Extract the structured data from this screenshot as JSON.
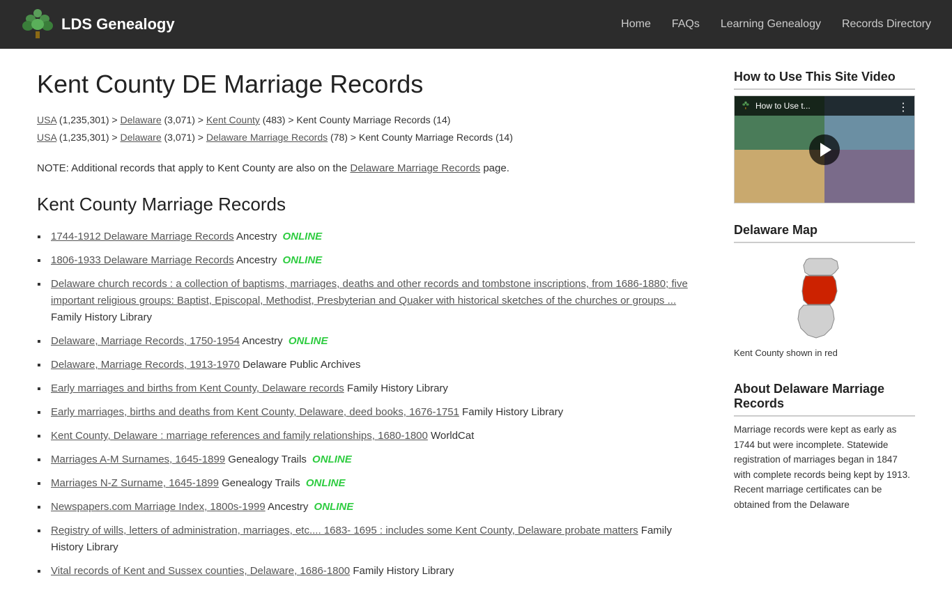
{
  "nav": {
    "logo_text": "LDS Genealogy",
    "links": [
      {
        "label": "Home",
        "href": "#"
      },
      {
        "label": "FAQs",
        "href": "#"
      },
      {
        "label": "Learning Genealogy",
        "href": "#"
      },
      {
        "label": "Records Directory",
        "href": "#"
      }
    ]
  },
  "main": {
    "page_title": "Kent County DE Marriage Records",
    "breadcrumbs": [
      {
        "line": "USA (1,235,301) > Delaware (3,071) > Kent County (483) > Kent County Marriage Records (14)",
        "links": [
          "USA",
          "Delaware",
          "Kent County"
        ]
      },
      {
        "line": "USA (1,235,301) > Delaware (3,071) > Delaware Marriage Records (78) > Kent County Marriage Records (14)",
        "links": [
          "USA",
          "Delaware",
          "Delaware Marriage Records"
        ]
      }
    ],
    "note": "NOTE: Additional records that apply to Kent County are also on the Delaware Marriage Records page.",
    "note_link": "Delaware Marriage Records",
    "section_title": "Kent County Marriage Records",
    "records": [
      {
        "link_text": "1744-1912 Delaware Marriage Records",
        "source": "Ancestry",
        "online": true
      },
      {
        "link_text": "1806-1933 Delaware Marriage Records",
        "source": "Ancestry",
        "online": true
      },
      {
        "link_text": "Delaware church records : a collection of baptisms, marriages, deaths and other records and tombstone inscriptions, from 1686-1880; five important religious groups: Baptist, Episcopal, Methodist, Presbyterian and Quaker with historical sketches of the churches or groups ...",
        "source": "Family History Library",
        "online": false
      },
      {
        "link_text": "Delaware, Marriage Records, 1750-1954",
        "source": "Ancestry",
        "online": true
      },
      {
        "link_text": "Delaware, Marriage Records, 1913-1970",
        "source": "Delaware Public Archives",
        "online": false
      },
      {
        "link_text": "Early marriages and births from Kent County, Delaware records",
        "source": "Family History Library",
        "online": false
      },
      {
        "link_text": "Early marriages, births and deaths from Kent County, Delaware, deed books, 1676-1751",
        "source": "Family History Library",
        "online": false
      },
      {
        "link_text": "Kent County, Delaware : marriage references and family relationships, 1680-1800",
        "source": "WorldCat",
        "online": false
      },
      {
        "link_text": "Marriages A-M Surnames, 1645-1899",
        "source": "Genealogy Trails",
        "online": true
      },
      {
        "link_text": "Marriages N-Z Surname, 1645-1899",
        "source": "Genealogy Trails",
        "online": true
      },
      {
        "link_text": "Newspapers.com Marriage Index, 1800s-1999",
        "source": "Ancestry",
        "online": true
      },
      {
        "link_text": "Registry of wills, letters of administration, marriages, etc.... 1683- 1695 : includes some Kent County, Delaware probate matters",
        "source": "Family History Library",
        "online": false
      },
      {
        "link_text": "Vital records of Kent and Sussex counties, Delaware, 1686-1800",
        "source": "Family History Library",
        "online": false
      }
    ]
  },
  "sidebar": {
    "video_section_title": "How to Use This Site Video",
    "video_label": "How to Use t...",
    "map_section_title": "Delaware Map",
    "map_caption": "Kent County shown in red",
    "about_section_title": "About Delaware Marriage Records",
    "about_text": "Marriage records were kept as early as 1744 but were incomplete. Statewide registration of marriages began in 1847 with complete records being kept by 1913. Recent marriage certificates can be obtained from the Delaware"
  }
}
